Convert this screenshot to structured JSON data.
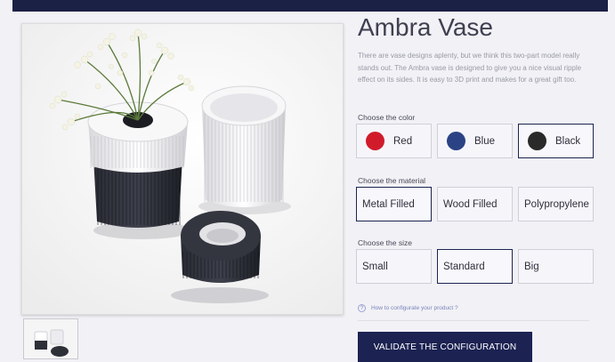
{
  "product": {
    "title": "Ambra Vase",
    "description": "There are vase designs aplenty, but we think this two-part model really stands out. The Ambra vase is designed to give you a nice visual ripple effect on its sides. It is easy to 3D print and makes for a great gift too."
  },
  "color": {
    "label": "Choose the color",
    "options": [
      {
        "label": "Red",
        "swatch": "#d11b2b",
        "selected": false
      },
      {
        "label": "Blue",
        "swatch": "#2b4384",
        "selected": false
      },
      {
        "label": "Black",
        "swatch": "#2a2a2a",
        "selected": true
      }
    ]
  },
  "material": {
    "label": "Choose the material",
    "options": [
      {
        "label": "Metal Filled",
        "selected": true
      },
      {
        "label": "Wood Filled",
        "selected": false
      },
      {
        "label": "Polypropylene",
        "selected": false
      }
    ]
  },
  "size": {
    "label": "Choose the size",
    "options": [
      {
        "label": "Small",
        "selected": false
      },
      {
        "label": "Standard",
        "selected": true
      },
      {
        "label": "Big",
        "selected": false
      }
    ]
  },
  "help": {
    "label": "How to configurate your product ?",
    "icon": "help-circle-icon"
  },
  "cta": {
    "label": "VALIDATE THE CONFIGURATION"
  },
  "colors": {
    "accent": "#1c2252",
    "topbar": "#1b2045"
  }
}
